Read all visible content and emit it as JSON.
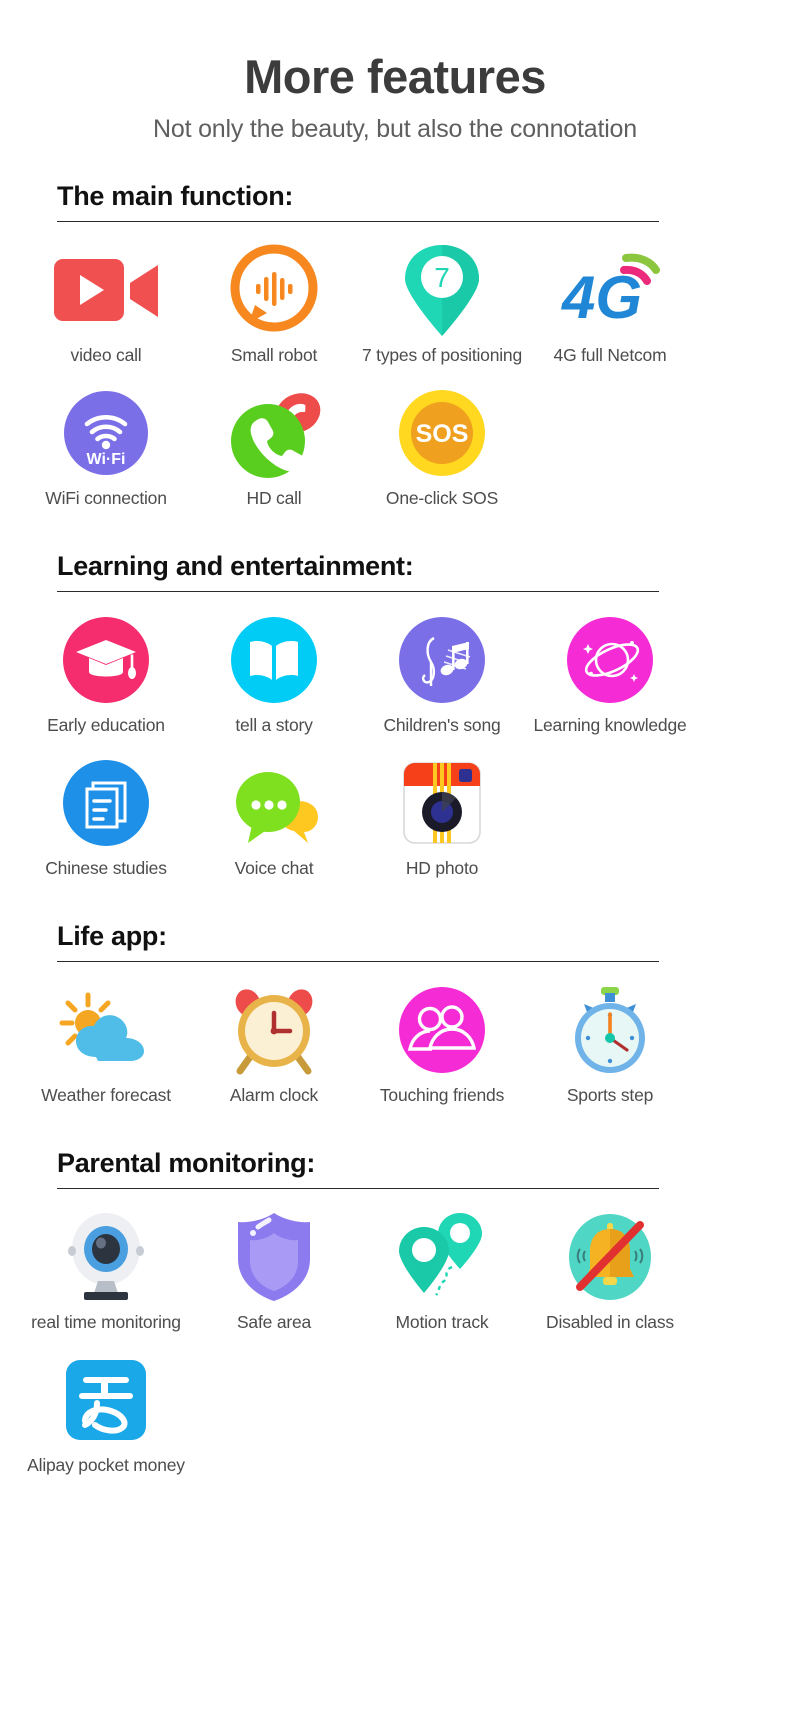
{
  "hero": {
    "title": "More features",
    "subtitle": "Not only the beauty, but also the connotation"
  },
  "colors": {
    "heading": "#111111",
    "label": "#4d4d4d",
    "rule": "#2b2b2b",
    "video_red": "#F0504F",
    "robot_orange": "#F7871F",
    "pin_teal": "#1FD6B5",
    "fourg_blue": "#1F87D6",
    "fourg_green": "#8CC63F",
    "fourg_pink": "#EC2A7B",
    "wifi_purple": "#7B6FE8",
    "phone_green": "#5ACE1F",
    "phone_red": "#EE4B4B",
    "sos_yellow": "#FFD81F",
    "sos_orange": "#F0A01F",
    "edu_pink": "#F52C6E",
    "book_cyan": "#00CCF5",
    "music_purple": "#7B6FE8",
    "planet_magenta": "#F52CD6",
    "chinese_blue": "#1E90E8",
    "chat_green": "#7FE020",
    "chat_yellow": "#FFC821",
    "camera_red": "#F5401A",
    "weather_blue": "#4FBDE8",
    "weather_sun": "#F5A623",
    "alarm_red": "#EE4B4B",
    "alarm_gold": "#E8B44A",
    "friends_magenta": "#F52CD6",
    "step_blue": "#3F8FD6",
    "webcam_blue": "#4A9FE0",
    "shield_purple": "#8C7BEF",
    "track_teal": "#1FD6B5",
    "bell_teal": "#4FD6C4",
    "bell_yellow": "#F5B323",
    "bell_bar_red": "#E03030",
    "alipay_blue": "#1BA8E8"
  },
  "sections": [
    {
      "id": "main-function",
      "title": "The main function:",
      "items": [
        {
          "icon": "video-call-icon",
          "label": "video call"
        },
        {
          "icon": "small-robot-icon",
          "label": "Small robot"
        },
        {
          "icon": "positioning-pin-icon",
          "label": "7 types of positioning",
          "badge": "7"
        },
        {
          "icon": "4g-netcom-icon",
          "label": "4G full Netcom",
          "text": "4G"
        },
        {
          "icon": "wifi-icon",
          "label": "WiFi connection",
          "text": "Wi·Fi"
        },
        {
          "icon": "hd-call-icon",
          "label": "HD call"
        },
        {
          "icon": "sos-icon",
          "label": "One-click SOS",
          "text": "SOS"
        }
      ]
    },
    {
      "id": "learning-entertainment",
      "title": "Learning and entertainment:",
      "items": [
        {
          "icon": "graduation-cap-icon",
          "label": "Early education"
        },
        {
          "icon": "open-book-icon",
          "label": "tell a story"
        },
        {
          "icon": "music-note-icon",
          "label": "Children's song"
        },
        {
          "icon": "planet-icon",
          "label": "Learning knowledge"
        },
        {
          "icon": "document-icon",
          "label": "Chinese studies"
        },
        {
          "icon": "chat-bubble-icon",
          "label": "Voice chat"
        },
        {
          "icon": "camera-icon",
          "label": "HD photo"
        }
      ]
    },
    {
      "id": "life-app",
      "title": "Life app:",
      "items": [
        {
          "icon": "weather-cloud-sun-icon",
          "label": "Weather forecast"
        },
        {
          "icon": "alarm-clock-icon",
          "label": "Alarm clock"
        },
        {
          "icon": "friends-icon",
          "label": "Touching friends"
        },
        {
          "icon": "stopwatch-icon",
          "label": "Sports step"
        }
      ]
    },
    {
      "id": "parental-monitoring",
      "title": "Parental monitoring:",
      "items": [
        {
          "icon": "webcam-icon",
          "label": "real time monitoring"
        },
        {
          "icon": "shield-icon",
          "label": "Safe area"
        },
        {
          "icon": "motion-track-icon",
          "label": "Motion track"
        },
        {
          "icon": "bell-disabled-icon",
          "label": "Disabled in class"
        },
        {
          "icon": "alipay-icon",
          "label": "Alipay pocket money"
        }
      ]
    }
  ]
}
